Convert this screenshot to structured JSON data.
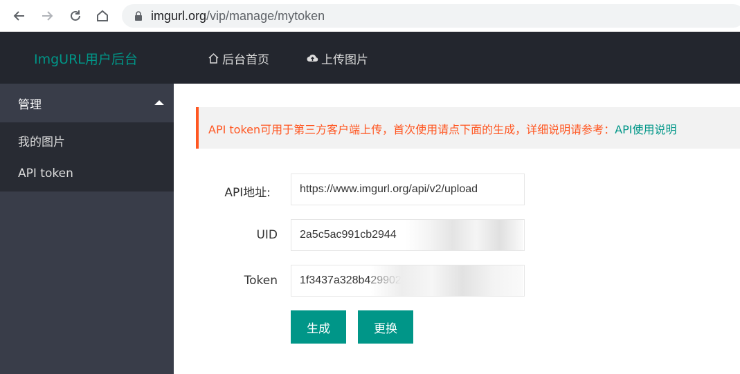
{
  "browser": {
    "url_host": "imgurl.org",
    "url_path": "/vip/manage/mytoken"
  },
  "header": {
    "logo": "ImgURL用户后台",
    "nav": [
      {
        "label": "后台首页",
        "icon": "home-icon"
      },
      {
        "label": "上传图片",
        "icon": "cloud-upload-icon"
      }
    ]
  },
  "sidebar": {
    "section_title": "管理",
    "items": [
      {
        "label": "我的图片"
      },
      {
        "label": "API token"
      }
    ]
  },
  "notice": {
    "text": "API token可用于第三方客户端上传，首次使用请点下面的生成，详细说明请参考：",
    "link": "API使用说明"
  },
  "form": {
    "api_label": "API地址:",
    "api_value": "https://www.imgurl.org/api/v2/upload",
    "uid_label": "UID",
    "uid_value": "2a5c5ac991cb2944",
    "token_label": "Token",
    "token_value": "1f3437a328b42990242c"
  },
  "buttons": {
    "generate": "生成",
    "change": "更换"
  },
  "colors": {
    "accent": "#009688",
    "warning": "#ff5722",
    "header_bg": "#23262e",
    "sidebar_bg": "#393d49"
  }
}
